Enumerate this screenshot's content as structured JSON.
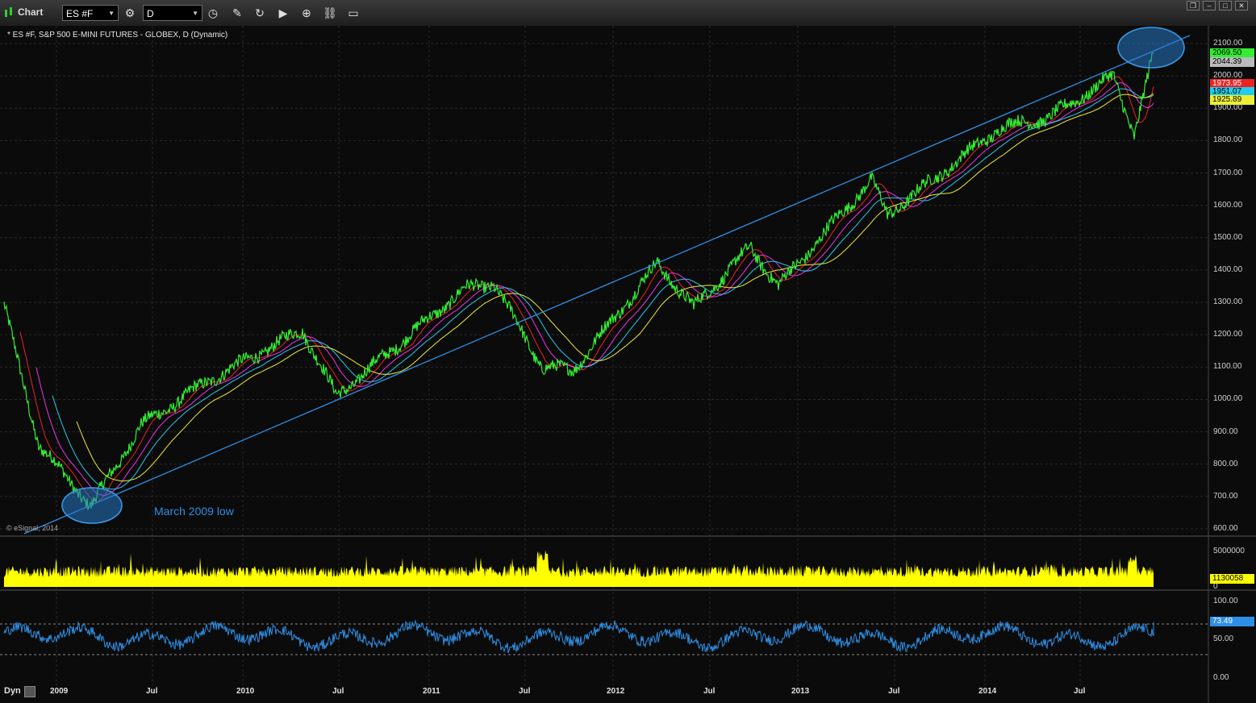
{
  "toolbar": {
    "app_title": "Chart",
    "symbol_value": "ES #F",
    "interval_value": "D"
  },
  "chart": {
    "title": "* ES #F, S&P 500 E-MINI FUTURES - GLOBEX, D (Dynamic)",
    "copyright": "© eSignal, 2014",
    "annotation": "March 2009 low",
    "price_axis_ticks": [
      "2100.00",
      "2000.00",
      "1900.00",
      "1800.00",
      "1700.00",
      "1600.00",
      "1500.00",
      "1400.00",
      "1300.00",
      "1200.00",
      "1100.00",
      "1000.00",
      "900.00",
      "800.00",
      "700.00",
      "600.00"
    ],
    "price_labels": {
      "last": "2069.50",
      "ma_gray": "2044.39",
      "ma_red": "1973.95",
      "ma_cyan": "1951.07",
      "ma_yellow": "1925.89"
    },
    "volume_axis_ticks": [
      "5000000",
      "0"
    ],
    "volume_last": "1130058",
    "rsi_axis_ticks": [
      "100.00",
      "50.00",
      "0.00"
    ],
    "rsi_last": "73.49",
    "time_axis": [
      "2009",
      "Jul",
      "2010",
      "Jul",
      "2011",
      "Jul",
      "2012",
      "Jul",
      "2013",
      "Jul",
      "2014",
      "Jul"
    ],
    "dyn_label": "Dyn"
  },
  "colors": {
    "price": "#33ee33",
    "ma_red": "#ee2222",
    "ma_magenta": "#ee33ee",
    "ma_cyan": "#22ccee",
    "ma_yellow": "#eeee33",
    "volume": "#ffff00",
    "rsi": "#2e8fe6",
    "trendline": "#2e8fe6"
  },
  "chart_data": {
    "type": "line",
    "price_anchors": {
      "x": [
        "2008-11",
        "2009-01",
        "2009-03",
        "2009-06",
        "2009-10",
        "2010-04",
        "2010-07",
        "2011-02",
        "2011-05",
        "2011-08",
        "2011-10",
        "2012-03",
        "2012-06",
        "2012-09",
        "2012-11",
        "2013-05",
        "2013-06",
        "2013-12",
        "2014-04",
        "2014-08",
        "2014-10",
        "2014-11"
      ],
      "y": [
        1290,
        860,
        670,
        920,
        1060,
        1215,
        1010,
        1340,
        1360,
        1100,
        1090,
        1420,
        1285,
        1470,
        1350,
        1680,
        1570,
        1840,
        1870,
        2000,
        1820,
        2069.5
      ]
    },
    "moving_averages_last": {
      "ma_red": 1973.95,
      "ma_magenta": 2044.39,
      "ma_cyan": 1951.07,
      "ma_yellow": 1925.89
    },
    "volume_last": 1130058,
    "rsi_last": 73.49,
    "price_ylim": [
      600,
      2100
    ],
    "rsi_ylim": [
      0,
      100
    ],
    "rsi_levels": [
      70,
      30
    ]
  }
}
